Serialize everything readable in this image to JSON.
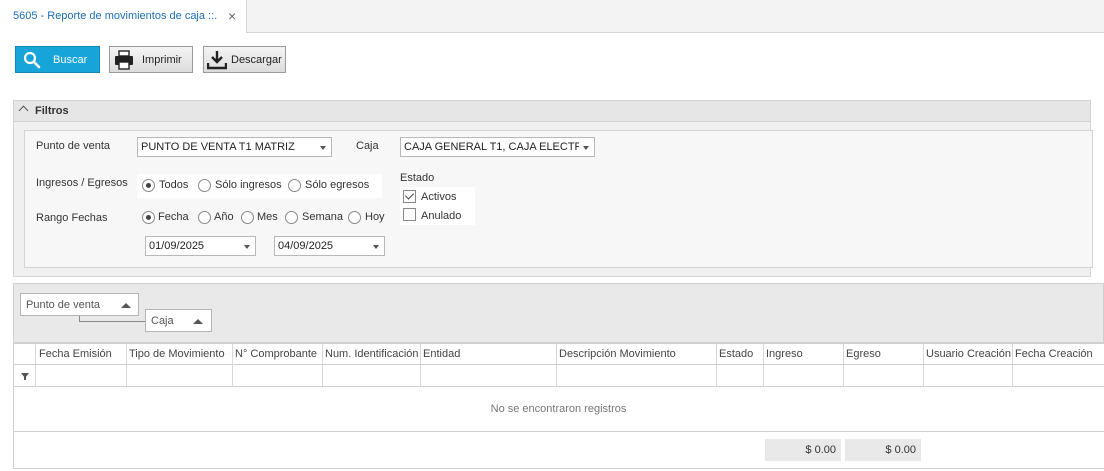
{
  "tab": {
    "title": "5605 - Reporte de movimientos de caja ::.",
    "close": "×"
  },
  "toolbar": {
    "buscar": "Buscar",
    "imprimir": "Imprimir",
    "descargar": "Descargar"
  },
  "filtros": {
    "title": "Filtros",
    "punto_venta_label": "Punto de venta",
    "punto_venta_value": "PUNTO DE VENTA T1 MATRIZ",
    "caja_label": "Caja",
    "caja_value": "CAJA GENERAL T1, CAJA ELECTR...",
    "ingresos_label": "Ingresos / Egresos",
    "ingresos_options": [
      "Todos",
      "Sólo ingresos",
      "Sólo egresos"
    ],
    "ingresos_selected": "Todos",
    "rango_label": "Rango Fechas",
    "rango_options": [
      "Fecha",
      "Año",
      "Mes",
      "Semana",
      "Hoy"
    ],
    "rango_selected": "Fecha",
    "fecha_desde": "01/09/2025",
    "fecha_hasta": "04/09/2025",
    "estado_label": "Estado",
    "estado_activos": "Activos",
    "estado_anulado": "Anulado",
    "estado_activos_checked": true,
    "estado_anulado_checked": false
  },
  "grouping": {
    "group1": "Punto de venta",
    "group2": "Caja"
  },
  "grid": {
    "columns": [
      "Fecha Emisión",
      "Tipo de Movimiento",
      "N° Comprobante",
      "Num. Identificación",
      "Entidad",
      "Descripción Movimiento",
      "Estado",
      "Ingreso",
      "Egreso",
      "Usuario Creación",
      "Fecha Creación"
    ],
    "empty_message": "No se encontraron registros",
    "total_ingreso": "$ 0.00",
    "total_egreso": "$ 0.00"
  },
  "colors": {
    "accent": "#17a5d9",
    "tab_text": "#1c6fb5"
  }
}
